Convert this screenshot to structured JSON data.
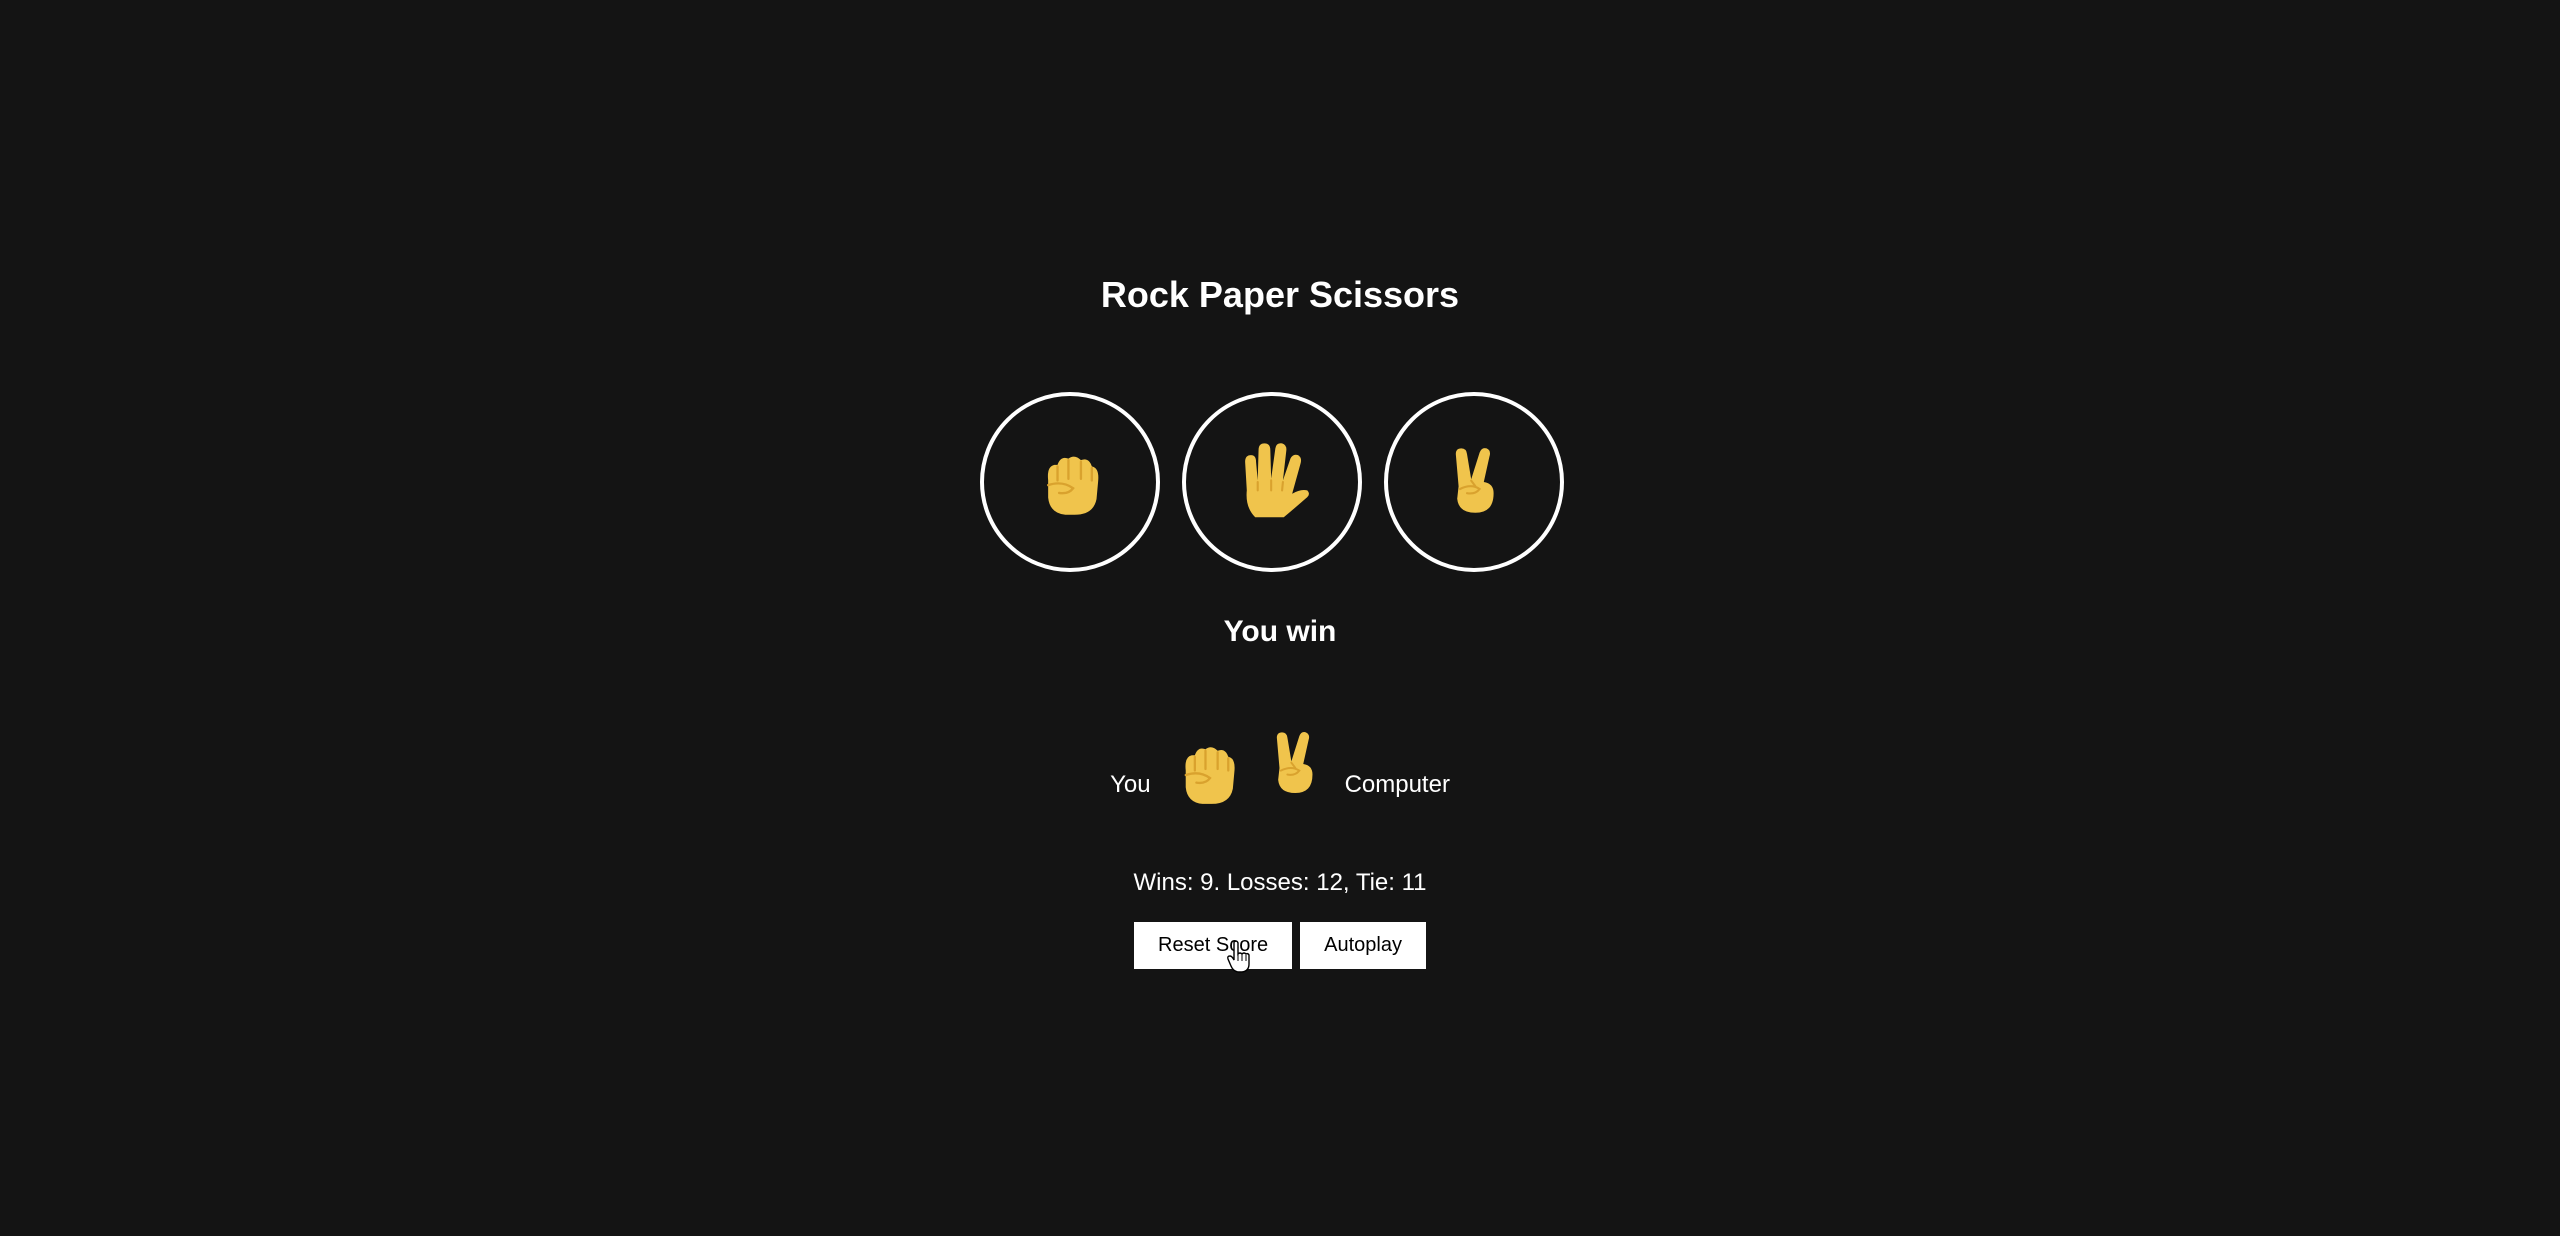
{
  "title": "Rock Paper Scissors",
  "moves": [
    {
      "name": "rock",
      "icon": "raised-fist-icon"
    },
    {
      "name": "paper",
      "icon": "raised-hand-icon"
    },
    {
      "name": "scissors",
      "icon": "victory-hand-icon"
    }
  ],
  "result": "You win",
  "picks": {
    "you_label": "You",
    "you_move": "rock",
    "computer_move": "scissors",
    "computer_label": "Computer"
  },
  "score_text": "Wins: 9. Losses: 12, Tie: 11",
  "controls": {
    "reset_label": "Reset Score",
    "autoplay_label": "Autoplay"
  },
  "colors": {
    "background": "#141414",
    "text": "#ffffff",
    "emoji_skin": "#f0c44c",
    "emoji_shade": "#d9a22e"
  }
}
